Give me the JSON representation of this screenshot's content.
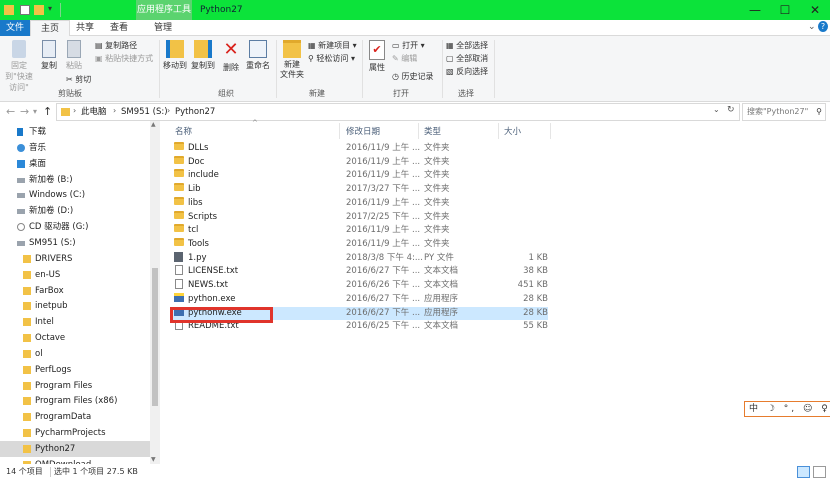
{
  "window": {
    "context_tab": "应用程序工具",
    "title": "Python27",
    "controls": {
      "minimize": "—",
      "maximize": "☐",
      "close": "✕"
    }
  },
  "ribbon_tabs": [
    "文件",
    "主页",
    "共享",
    "查看",
    "管理"
  ],
  "ribbon": {
    "clipboard": {
      "pin": "固定到\"快速访问\"",
      "copy": "复制",
      "paste": "粘贴",
      "copy_path": "复制路径",
      "paste_shortcut": "粘贴快捷方式",
      "cut": "剪切",
      "group": "剪贴板"
    },
    "organize": {
      "move_to": "移动到",
      "copy_to": "复制到",
      "delete": "删除",
      "rename": "重命名",
      "group": "组织"
    },
    "new": {
      "new_folder": "新建\n文件夹",
      "new_item": "新建项目",
      "easy_access": "轻松访问",
      "group": "新建"
    },
    "open": {
      "properties": "属性",
      "open": "打开",
      "edit": "编辑",
      "history": "历史记录",
      "group": "打开"
    },
    "select": {
      "select_all": "全部选择",
      "select_none": "全部取消",
      "invert": "反向选择",
      "group": "选择"
    }
  },
  "address": {
    "breadcrumb": [
      "此电脑",
      "SM951 (S:)",
      "Python27"
    ],
    "search_placeholder": "搜索\"Python27\""
  },
  "nav_items": [
    {
      "label": "下载",
      "icon": "download-icon"
    },
    {
      "label": "音乐",
      "icon": "music-icon"
    },
    {
      "label": "桌面",
      "icon": "desktop-icon"
    },
    {
      "label": "新加卷 (B:)",
      "icon": "drive-icon"
    },
    {
      "label": "Windows (C:)",
      "icon": "drive-icon"
    },
    {
      "label": "新加卷 (D:)",
      "icon": "drive-icon"
    },
    {
      "label": "CD 驱动器 (G:)",
      "icon": "cd-drive-icon"
    },
    {
      "label": "SM951 (S:)",
      "icon": "drive-icon"
    },
    {
      "label": "DRIVERS",
      "icon": "folder-icon"
    },
    {
      "label": "en-US",
      "icon": "folder-icon"
    },
    {
      "label": "FarBox",
      "icon": "folder-icon"
    },
    {
      "label": "inetpub",
      "icon": "folder-icon"
    },
    {
      "label": "Intel",
      "icon": "folder-icon"
    },
    {
      "label": "Octave",
      "icon": "folder-icon"
    },
    {
      "label": "ol",
      "icon": "folder-icon"
    },
    {
      "label": "PerfLogs",
      "icon": "folder-icon"
    },
    {
      "label": "Program Files",
      "icon": "folder-icon"
    },
    {
      "label": "Program Files (x86)",
      "icon": "folder-icon"
    },
    {
      "label": "ProgramData",
      "icon": "folder-icon"
    },
    {
      "label": "PycharmProjects",
      "icon": "folder-icon"
    },
    {
      "label": "Python27",
      "icon": "folder-icon"
    },
    {
      "label": "QMDownload",
      "icon": "folder-icon"
    }
  ],
  "columns": {
    "name": "名称",
    "date": "修改日期",
    "type": "类型",
    "size": "大小"
  },
  "files": [
    {
      "name": "DLLs",
      "date": "2016/11/9 上午 ...",
      "type": "文件夹",
      "size": "",
      "kind": "folder"
    },
    {
      "name": "Doc",
      "date": "2016/11/9 上午 ...",
      "type": "文件夹",
      "size": "",
      "kind": "folder"
    },
    {
      "name": "include",
      "date": "2016/11/9 上午 ...",
      "type": "文件夹",
      "size": "",
      "kind": "folder"
    },
    {
      "name": "Lib",
      "date": "2017/3/27 下午 ...",
      "type": "文件夹",
      "size": "",
      "kind": "folder"
    },
    {
      "name": "libs",
      "date": "2016/11/9 上午 ...",
      "type": "文件夹",
      "size": "",
      "kind": "folder"
    },
    {
      "name": "Scripts",
      "date": "2017/2/25 下午 ...",
      "type": "文件夹",
      "size": "",
      "kind": "folder"
    },
    {
      "name": "tcl",
      "date": "2016/11/9 上午 ...",
      "type": "文件夹",
      "size": "",
      "kind": "folder"
    },
    {
      "name": "Tools",
      "date": "2016/11/9 上午 ...",
      "type": "文件夹",
      "size": "",
      "kind": "folder"
    },
    {
      "name": "1.py",
      "date": "2018/3/8 下午 4:...",
      "type": "PY 文件",
      "size": "1 KB",
      "kind": "py"
    },
    {
      "name": "LICENSE.txt",
      "date": "2016/6/27 下午 ...",
      "type": "文本文档",
      "size": "38 KB",
      "kind": "doc"
    },
    {
      "name": "NEWS.txt",
      "date": "2016/6/26 下午 ...",
      "type": "文本文档",
      "size": "451 KB",
      "kind": "doc"
    },
    {
      "name": "python.exe",
      "date": "2016/6/27 下午 ...",
      "type": "应用程序",
      "size": "28 KB",
      "kind": "exe"
    },
    {
      "name": "pythonw.exe",
      "date": "2016/6/27 下午 ...",
      "type": "应用程序",
      "size": "28 KB",
      "kind": "exe"
    },
    {
      "name": "README.txt",
      "date": "2016/6/25 下午 ...",
      "type": "文本文档",
      "size": "55 KB",
      "kind": "doc"
    }
  ],
  "ime": "中 ☽ °, ☺ ♀ ✎",
  "status": {
    "count": "14 个项目",
    "selected": "选中 1 个项目  27.5 KB"
  },
  "colors": {
    "titlebar": "#0ce33a",
    "file_tab": "#1979ca",
    "selection": "#cce8ff",
    "highlight": "#e0342b"
  }
}
